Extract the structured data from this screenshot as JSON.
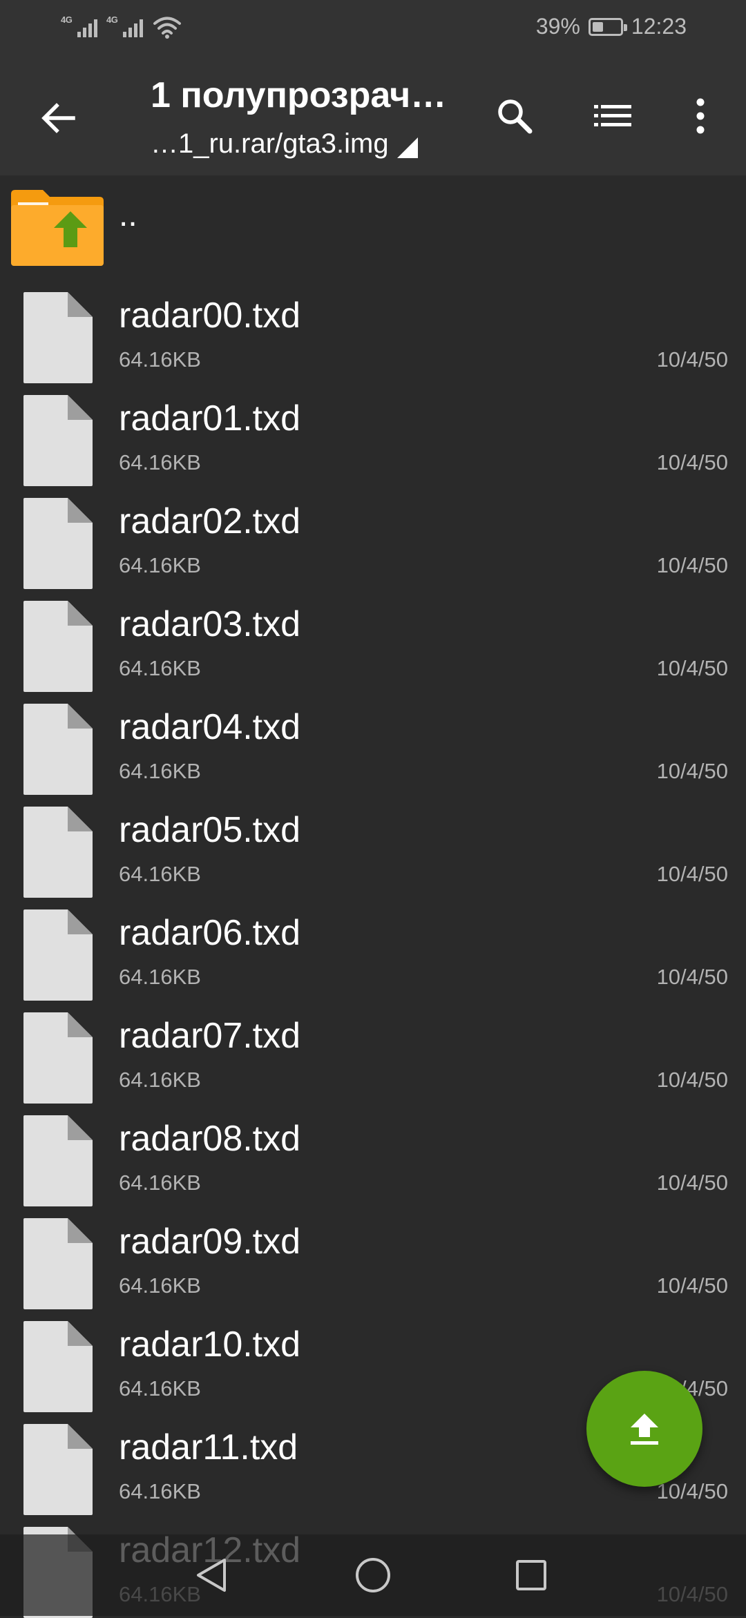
{
  "status_bar": {
    "network_1": "4G",
    "network_2": "4G",
    "battery_percent": "39%",
    "battery_level": 0.39,
    "time": "12:23",
    "icons": [
      "signal-icon",
      "signal-icon",
      "wifi-icon",
      "battery-icon"
    ]
  },
  "app_bar": {
    "title": "1 полупрозрач…",
    "path": "…1_ru.rar/gta3.img",
    "icons": [
      "back-arrow-icon",
      "search-icon",
      "list-view-icon",
      "more-vert-icon"
    ]
  },
  "list": {
    "parent_label": "..",
    "parent_icon": "folder-up-icon",
    "items": [
      {
        "name": "radar00.txd",
        "size": "64.16KB",
        "date": "10/4/50"
      },
      {
        "name": "radar01.txd",
        "size": "64.16KB",
        "date": "10/4/50"
      },
      {
        "name": "radar02.txd",
        "size": "64.16KB",
        "date": "10/4/50"
      },
      {
        "name": "radar03.txd",
        "size": "64.16KB",
        "date": "10/4/50"
      },
      {
        "name": "radar04.txd",
        "size": "64.16KB",
        "date": "10/4/50"
      },
      {
        "name": "radar05.txd",
        "size": "64.16KB",
        "date": "10/4/50"
      },
      {
        "name": "radar06.txd",
        "size": "64.16KB",
        "date": "10/4/50"
      },
      {
        "name": "radar07.txd",
        "size": "64.16KB",
        "date": "10/4/50"
      },
      {
        "name": "radar08.txd",
        "size": "64.16KB",
        "date": "10/4/50"
      },
      {
        "name": "radar09.txd",
        "size": "64.16KB",
        "date": "10/4/50"
      },
      {
        "name": "radar10.txd",
        "size": "64.16KB",
        "date": "10/4/50"
      },
      {
        "name": "radar11.txd",
        "size": "64.16KB",
        "date": "10/4/50"
      },
      {
        "name": "radar12.txd",
        "size": "64.16KB",
        "date": "10/4/50"
      }
    ]
  },
  "fab": {
    "icon": "upload-icon",
    "color": "#5aa314"
  },
  "nav_bar": {
    "icons": [
      "nav-back-icon",
      "nav-home-icon",
      "nav-recents-icon"
    ]
  },
  "colors": {
    "background": "#2a2a2a",
    "app_bar": "#333333",
    "folder": "#f7a21b",
    "folder_arrow": "#5b9b14",
    "file": "#e0e0e0",
    "secondary_text": "#b3b3b3"
  }
}
